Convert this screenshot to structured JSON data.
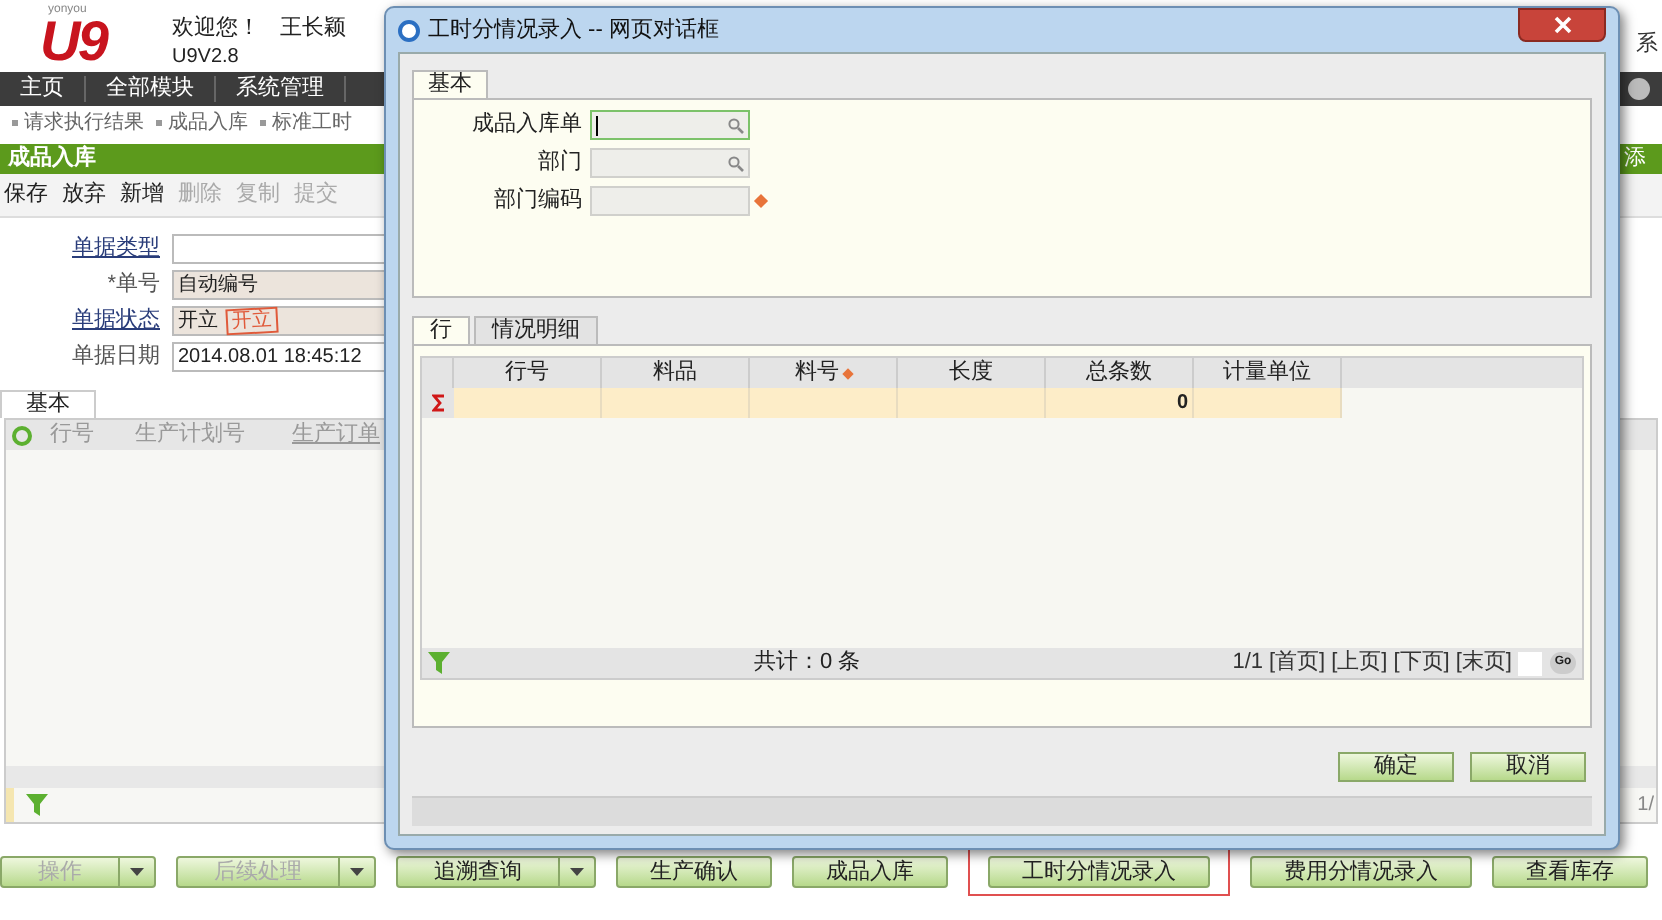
{
  "header": {
    "brand": "yonyou",
    "logo": "U9",
    "welcome": "欢迎您！",
    "user": "王长颖",
    "version": "U9V2.8",
    "right_text": "系"
  },
  "nav": [
    "主页",
    "全部模块",
    "系统管理"
  ],
  "breadcrumbs": [
    "请求执行结果",
    "成品入库",
    "标准工时"
  ],
  "page_title": "成品入库",
  "page_action": "添",
  "toolbar": [
    {
      "label": "保存",
      "disabled": false
    },
    {
      "label": "放弃",
      "disabled": false
    },
    {
      "label": "新增",
      "disabled": false
    },
    {
      "label": "删除",
      "disabled": true
    },
    {
      "label": "复制",
      "disabled": true
    },
    {
      "label": "提交",
      "disabled": true
    }
  ],
  "form": [
    {
      "label": "单据类型",
      "link": true,
      "kind": "input"
    },
    {
      "label": "*单号",
      "link": false,
      "value": "自动编号",
      "kind": "readonly"
    },
    {
      "label": "单据状态",
      "link": true,
      "value": "开立",
      "stamp": "开立",
      "kind": "readonly"
    },
    {
      "label": "单据日期",
      "link": false,
      "value": "2014.08.01 18:45:12",
      "kind": "input"
    }
  ],
  "grid": {
    "tab": "基本",
    "columns": [
      "行号",
      "生产计划号",
      "生产订单"
    ],
    "pager": "1/"
  },
  "bottom_buttons": [
    {
      "label": "操作",
      "dropdown": true,
      "disabled": true,
      "selected": false
    },
    {
      "label": "后续处理",
      "dropdown": true,
      "disabled": true,
      "selected": false
    },
    {
      "label": "追溯查询",
      "dropdown": true,
      "disabled": false,
      "selected": false
    },
    {
      "label": "生产确认",
      "dropdown": false,
      "disabled": false,
      "selected": false
    },
    {
      "label": "成品入库",
      "dropdown": false,
      "disabled": false,
      "selected": false
    },
    {
      "label": "工时分情况录入",
      "dropdown": false,
      "disabled": false,
      "selected": true
    },
    {
      "label": "费用分情况录入",
      "dropdown": false,
      "disabled": false,
      "selected": false
    },
    {
      "label": "查看库存",
      "dropdown": false,
      "disabled": false,
      "selected": false
    }
  ],
  "dialog": {
    "title": "工时分情况录入 -- 网页对话框",
    "tabs": [
      {
        "label": "基本",
        "selected": true
      }
    ],
    "fields": [
      {
        "label": "成品入库单",
        "lookup": true,
        "required": false,
        "focused": true
      },
      {
        "label": "部门",
        "lookup": true,
        "required": false,
        "focused": false
      },
      {
        "label": "部门编码",
        "lookup": false,
        "required": true,
        "focused": false
      }
    ],
    "detail_tabs": [
      {
        "label": "行",
        "selected": true
      },
      {
        "label": "情况明细",
        "selected": false
      }
    ],
    "columns": [
      {
        "label": "行号",
        "required": false
      },
      {
        "label": "料品",
        "required": false
      },
      {
        "label": "料号",
        "required": true
      },
      {
        "label": "长度",
        "required": false
      },
      {
        "label": "总条数",
        "required": false,
        "sum": "0"
      },
      {
        "label": "计量单位",
        "required": false
      }
    ],
    "total": "共计：0 条",
    "pager": {
      "page": "1/1",
      "links": [
        "[首页]",
        "[上页]",
        "[下页]",
        "[末页]"
      ],
      "go": "Go"
    },
    "buttons": [
      "确定",
      "取消"
    ]
  }
}
